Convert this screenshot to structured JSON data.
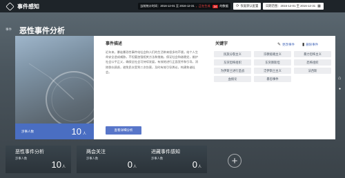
{
  "header": {
    "app_title": "事件感知",
    "info": {
      "label": "当前统计时间：",
      "range": "2016-12-01 至 2016-12-31",
      "status": "，正在生成",
      "count_badge": "34",
      "tail": "的数据"
    },
    "restore_btn": "恢复默认配置",
    "date_label": "日期范围：",
    "date_range": "2016-12-01 至 2016-12-31"
  },
  "section_label": "事件",
  "page_title": "恶性事件分析",
  "card": {
    "photo_label": "涉事人数",
    "photo_count": "10",
    "photo_unit": "人",
    "desc_title": "事件描述",
    "desc_text": "近年来，暴徒暴恐性事件给社会和人们的生活带来很多的不便。给个人生命安全造成威胁，不但要加强相关方法和措施，保证社会和谐稳定，维护社会公平正义，确保全社会可持续发展，有效地进行正面宣传和引导，消除群众顾虑，避免民众受到二次伤害，及时有效引导舆论，构建和谐社会。",
    "desc_link": "查看详细分析",
    "keywords_title": "关键字",
    "edit_label": "更改事件",
    "delete_label": "删除事件",
    "tags": [
      "民族分裂主义",
      "宗教极端主义",
      "暴力恐怖主义",
      "东突恐怖组织",
      "东突厥斯坦",
      "恐怖组织",
      "为伊斯兰进行圣战",
      "泛伊斯兰主义",
      "法西斯",
      "血统论",
      "暴恐事件"
    ]
  },
  "tiles": [
    {
      "name": "恶性事件分析",
      "sub": "涉事人数",
      "count": "10",
      "unit": "人"
    },
    {
      "name": "两会关注",
      "sub": "涉事人数",
      "count": "0",
      "unit": "人"
    },
    {
      "name": "进藏事件感知",
      "sub": "涉事人数",
      "count": "0",
      "unit": "人"
    }
  ],
  "add_tile_symbol": "+",
  "side": {
    "home_icon": "⌂",
    "marker": "●"
  },
  "colors": {
    "accent": "#5876c9",
    "topbar": "#1e2429",
    "badge": "#d21c1c",
    "tag_bg": "#ecedf0"
  }
}
